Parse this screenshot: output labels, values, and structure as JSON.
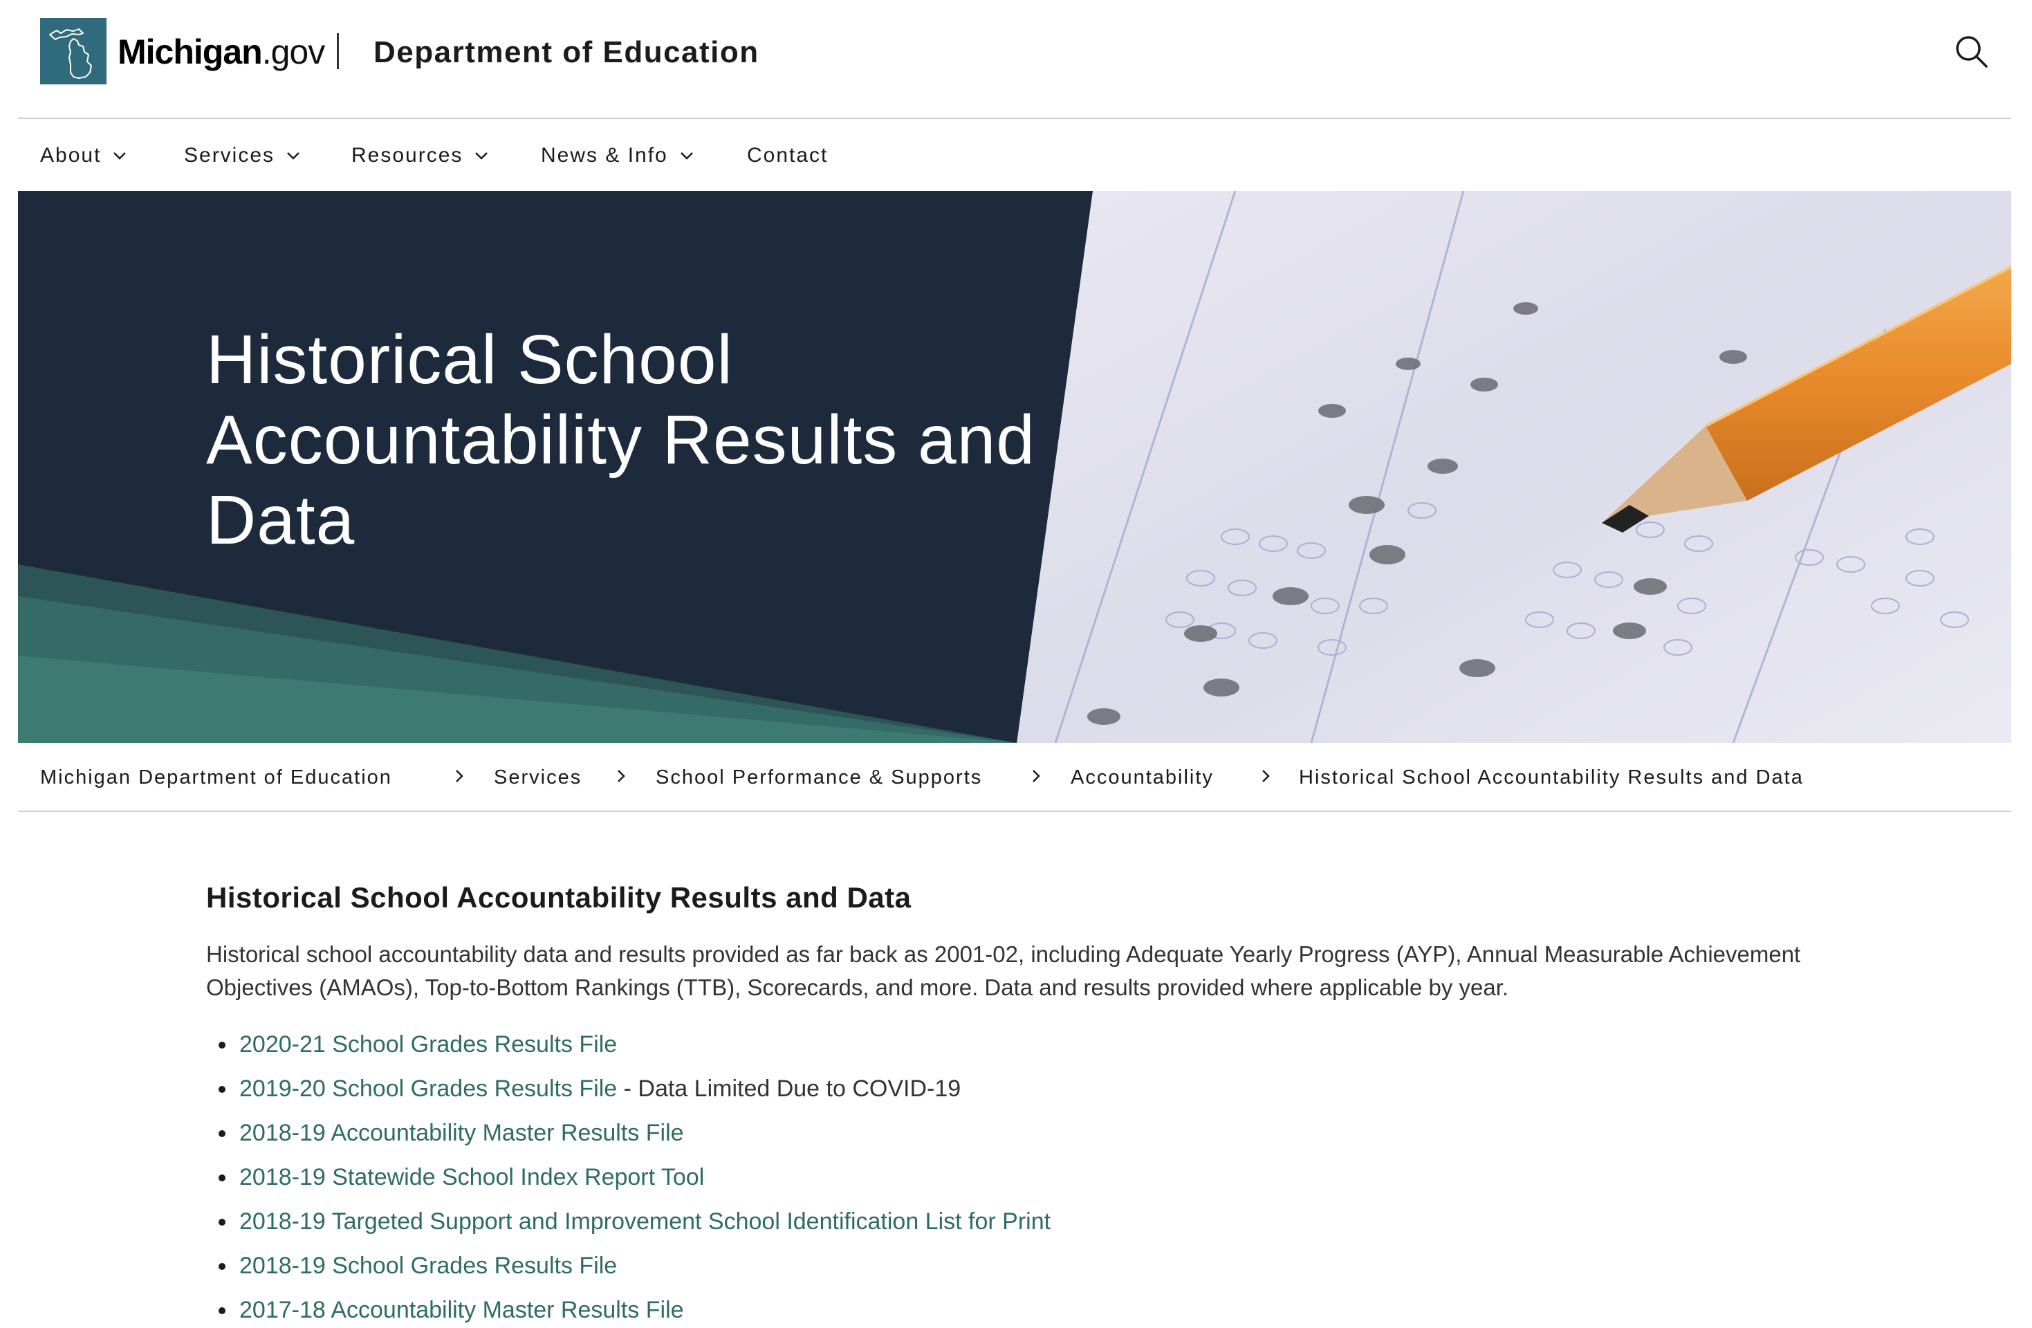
{
  "header": {
    "wordmark_bold": "Michigan",
    "wordmark_light": ".gov",
    "department": "Department of Education",
    "search_icon": "search-icon",
    "logo_icon": "michigan-map-icon"
  },
  "nav": {
    "items": [
      {
        "label": "About",
        "has_dropdown": true
      },
      {
        "label": "Services",
        "has_dropdown": true
      },
      {
        "label": "Resources",
        "has_dropdown": true
      },
      {
        "label": "News & Info",
        "has_dropdown": true
      },
      {
        "label": "Contact",
        "has_dropdown": false
      }
    ],
    "dropdown_icon": "chevron-down-icon"
  },
  "hero": {
    "title": "Historical School Accountability Results and Data",
    "background": "Test answer sheet with pencil"
  },
  "breadcrumb": {
    "items": [
      "Michigan Department of Education",
      "Services",
      "School Performance & Supports",
      "Accountability",
      "Historical School Accountability Results and Data"
    ],
    "separator_icon": "chevron-right-icon"
  },
  "main": {
    "heading": "Historical School Accountability Results and Data",
    "intro": "Historical school accountability data and results provided as far back as 2001-02, including Adequate Yearly Progress (AYP), Annual Measurable Achievement Objectives (AMAOs), Top-to-Bottom Rankings (TTB), Scorecards, and more. Data and results provided where applicable by year.",
    "links": [
      {
        "label": "2020-21 School Grades Results File",
        "note": ""
      },
      {
        "label": "2019-20 School Grades Results File",
        "note": " - Data Limited Due to COVID-19"
      },
      {
        "label": "2018-19 Accountability Master Results File",
        "note": ""
      },
      {
        "label": "2018-19 Statewide School Index Report Tool",
        "note": ""
      },
      {
        "label": "2018-19 Targeted Support and Improvement School Identification List for Print",
        "note": ""
      },
      {
        "label": "2018-19 School Grades Results File",
        "note": ""
      },
      {
        "label": "2017-18 Accountability Master Results File",
        "note": ""
      }
    ]
  },
  "colors": {
    "logo_bg": "#2f6b7c",
    "hero_navy": "#1c2a3b",
    "hero_teal": "#3d7a72",
    "link": "#2e6b64",
    "rule": "#cfcfcf"
  }
}
